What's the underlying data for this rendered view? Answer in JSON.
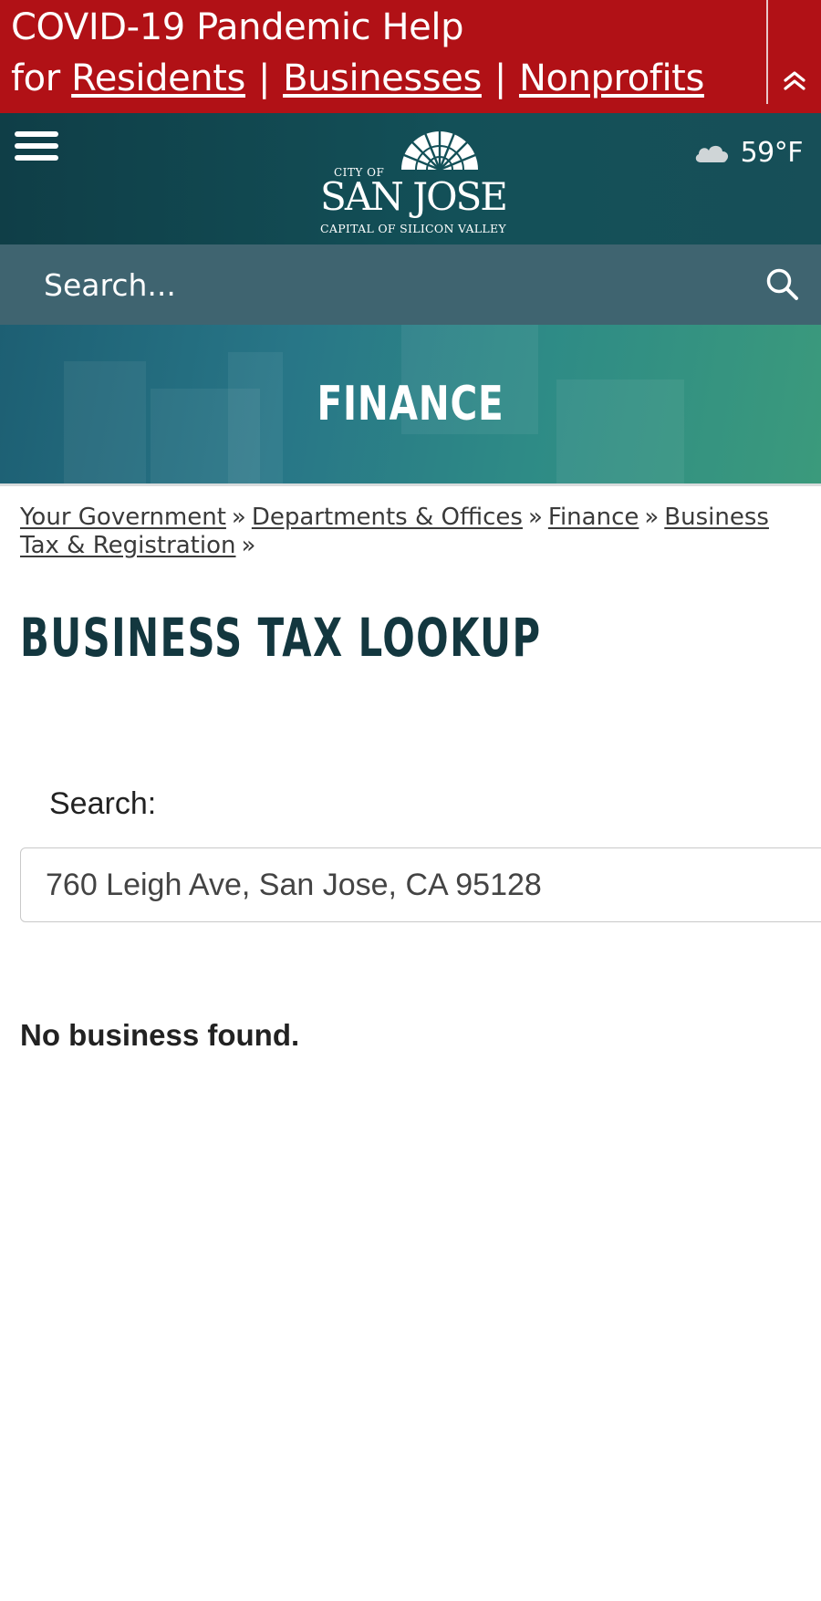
{
  "covid_banner": {
    "title": "COVID-19 Pandemic Help",
    "prefix": "for",
    "links": [
      "Residents",
      "Businesses",
      "Nonprofits"
    ],
    "separator": "|"
  },
  "header": {
    "logo": {
      "small_text": "CITY OF",
      "main_text": "SAN JOSE",
      "sub_text": "CAPITAL OF SILICON VALLEY"
    },
    "weather": {
      "icon": "cloud-icon",
      "temperature": "59°F"
    }
  },
  "site_search": {
    "placeholder": "Search..."
  },
  "hero": {
    "title": "FINANCE"
  },
  "breadcrumb": {
    "items": [
      "Your Government",
      "Departments & Offices",
      "Finance",
      "Business Tax & Registration"
    ],
    "separator": "»"
  },
  "page": {
    "title": "BUSINESS TAX LOOKUP"
  },
  "lookup": {
    "label": "Search:",
    "value": "760 Leigh Ave, San Jose, CA 95128",
    "result_message": "No business found."
  },
  "colors": {
    "banner_red": "#b11116",
    "header_teal": "#135058",
    "search_bar": "#3f6470",
    "title_dark": "#13373f"
  }
}
